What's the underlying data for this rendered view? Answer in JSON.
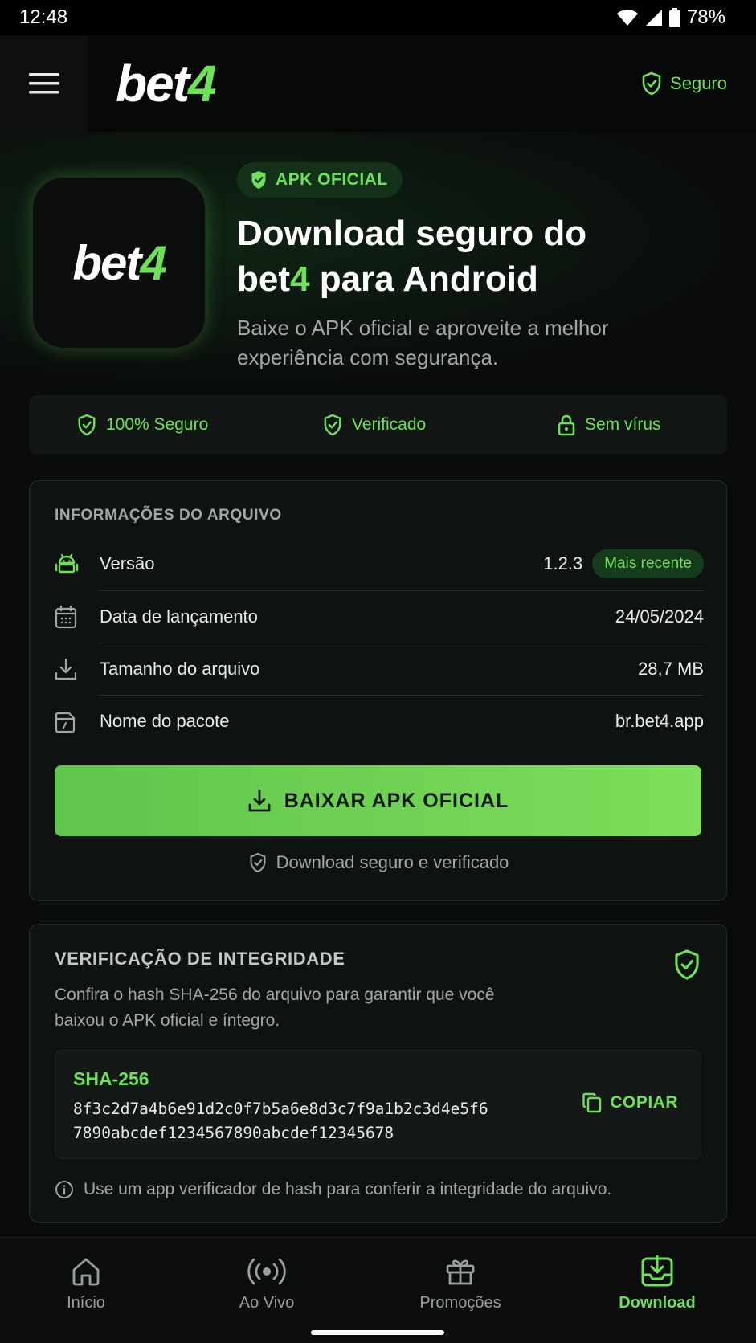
{
  "status_bar": {
    "time": "12:48",
    "battery": "78%"
  },
  "header": {
    "logo": {
      "text": "bet",
      "accent": "4"
    },
    "secure_label": "Seguro"
  },
  "hero": {
    "badge": "APK OFICIAL",
    "title_line1": "Download seguro do",
    "title_brand": "bet",
    "title_brand_accent": "4",
    "title_rest": " para Android",
    "subtitle": "Baixe o APK oficial e aproveite a melhor experiência com segurança."
  },
  "trust": [
    {
      "label": "100% Seguro",
      "icon": "shield-check-icon"
    },
    {
      "label": "Verificado",
      "icon": "shield-check-icon"
    },
    {
      "label": "Sem vírus",
      "icon": "lock-icon"
    }
  ],
  "file_info": {
    "heading": "INFORMAÇÕES DO ARQUIVO",
    "rows": [
      {
        "label": "Versão",
        "value": "1.2.3",
        "icon": "android-icon",
        "badge": "Mais recente"
      },
      {
        "label": "Data de lançamento",
        "value": "24/05/2024",
        "icon": "calendar-icon"
      },
      {
        "label": "Tamanho do arquivo",
        "value": "28,7 MB",
        "icon": "download-icon"
      },
      {
        "label": "Nome do pacote",
        "value": "br.bet4.app",
        "icon": "package-icon"
      }
    ],
    "download_button": "BAIXAR APK OFICIAL",
    "secure_note": "Download seguro e verificado"
  },
  "integrity": {
    "heading": "VERIFICAÇÃO DE INTEGRIDADE",
    "description": "Confira o hash SHA-256 do arquivo para garantir que você baixou o APK oficial e íntegro.",
    "hash_label": "SHA-256",
    "hash_line1": "8f3c2d7a4b6e91d2c0f7b5a6e8d3c7f9a1b2c3d4e5f6",
    "hash_line2": "7890abcdef1234567890abcdef12345678",
    "copy_label": "COPIAR",
    "hint": "Use um app verificador de hash para conferir a integridade do arquivo."
  },
  "bottom_nav": [
    {
      "label": "Início",
      "icon": "home-icon",
      "active": false
    },
    {
      "label": "Ao Vivo",
      "icon": "live-broadcast-icon",
      "active": false
    },
    {
      "label": "Promoções",
      "icon": "gift-icon",
      "active": false
    },
    {
      "label": "Download",
      "icon": "download-tray-icon",
      "active": true
    }
  ],
  "colors": {
    "accent": "#6fe05a",
    "background": "#0a0c0b",
    "card": "#0e1211",
    "muted_text": "#a3a8a5"
  }
}
